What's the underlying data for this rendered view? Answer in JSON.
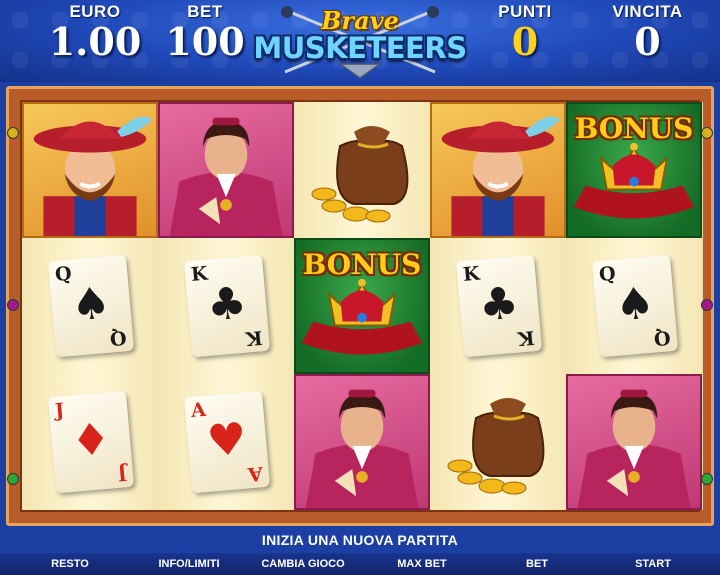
{
  "header": {
    "euro_label": "EURO",
    "euro_value": "1.00",
    "bet_label": "BET",
    "bet_value": "100",
    "punti_label": "PUNTI",
    "punti_value": "0",
    "vincita_label": "VINCITA",
    "vincita_value": "0",
    "logo_top": "Brave",
    "logo_main": "MUSKETEERS"
  },
  "reels": [
    [
      {
        "symbol": "musketeer"
      },
      {
        "symbol": "card",
        "rank": "Q",
        "suit": "♠",
        "color": "black"
      },
      {
        "symbol": "card",
        "rank": "J",
        "suit": "♦",
        "color": "red"
      }
    ],
    [
      {
        "symbol": "cardinal"
      },
      {
        "symbol": "card",
        "rank": "K",
        "suit": "♣",
        "color": "black"
      },
      {
        "symbol": "card",
        "rank": "A",
        "suit": "♥",
        "color": "red"
      }
    ],
    [
      {
        "symbol": "gold-bag"
      },
      {
        "symbol": "bonus",
        "label": "BONUS"
      },
      {
        "symbol": "cardinal"
      }
    ],
    [
      {
        "symbol": "musketeer"
      },
      {
        "symbol": "card",
        "rank": "K",
        "suit": "♣",
        "color": "black"
      },
      {
        "symbol": "gold-bag"
      }
    ],
    [
      {
        "symbol": "bonus",
        "label": "BONUS"
      },
      {
        "symbol": "card",
        "rank": "Q",
        "suit": "♠",
        "color": "black"
      },
      {
        "symbol": "cardinal"
      }
    ]
  ],
  "status_message": "INIZIA UNA NUOVA PARTITA",
  "toolbar": {
    "resto": "RESTO",
    "info": "INFO/LIMITI",
    "cambia": "CAMBIA GIOCO",
    "maxbet": "MAX BET",
    "bet": "BET",
    "start": "START"
  },
  "colors": {
    "header_blue": "#1f48b8",
    "frame_brown": "#b85c2a",
    "value_gold": "#ffd21a",
    "bonus_green": "#146b25"
  }
}
